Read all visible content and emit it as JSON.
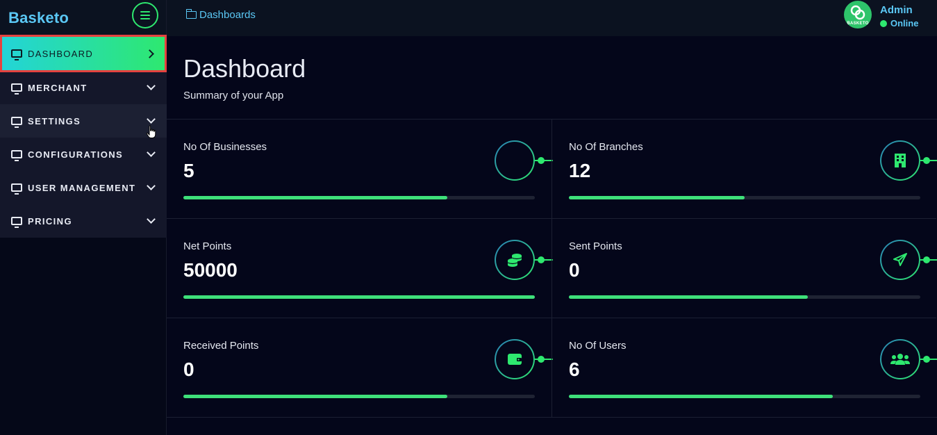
{
  "app": {
    "brand": "Basketo"
  },
  "sidebar": {
    "items": [
      {
        "label": "DASHBOARD",
        "icon": "monitor-icon",
        "active": true
      },
      {
        "label": "MERCHANT",
        "icon": "monitor-icon"
      },
      {
        "label": "SETTINGS",
        "icon": "monitor-icon"
      },
      {
        "label": "CONFIGURATIONS",
        "icon": "monitor-icon"
      },
      {
        "label": "USER MANAGEMENT",
        "icon": "monitor-icon"
      },
      {
        "label": "PRICING",
        "icon": "monitor-icon"
      }
    ]
  },
  "topbar": {
    "breadcrumb": "Dashboards",
    "user": {
      "name": "Admin",
      "status": "Online",
      "avatar_text": "BASKETO"
    }
  },
  "page": {
    "title": "Dashboard",
    "subtitle": "Summary of your App"
  },
  "stats": [
    {
      "label": "No Of Businesses",
      "value": "5",
      "progress": 0.75,
      "icon": "circle-icon"
    },
    {
      "label": "No Of Branches",
      "value": "12",
      "progress": 0.5,
      "icon": "building-icon"
    },
    {
      "label": "Net Points",
      "value": "50000",
      "progress": 1.0,
      "icon": "coins-icon"
    },
    {
      "label": "Sent Points",
      "value": "0",
      "progress": 0.68,
      "icon": "paper-plane-icon"
    },
    {
      "label": "Received Points",
      "value": "0",
      "progress": 0.75,
      "icon": "wallet-icon"
    },
    {
      "label": "No Of Users",
      "value": "6",
      "progress": 0.75,
      "icon": "users-icon"
    }
  ],
  "colors": {
    "accent": "#2ee86f",
    "brand": "#5bc8f5",
    "background": "#04061a",
    "highlight": "#e5423f"
  }
}
